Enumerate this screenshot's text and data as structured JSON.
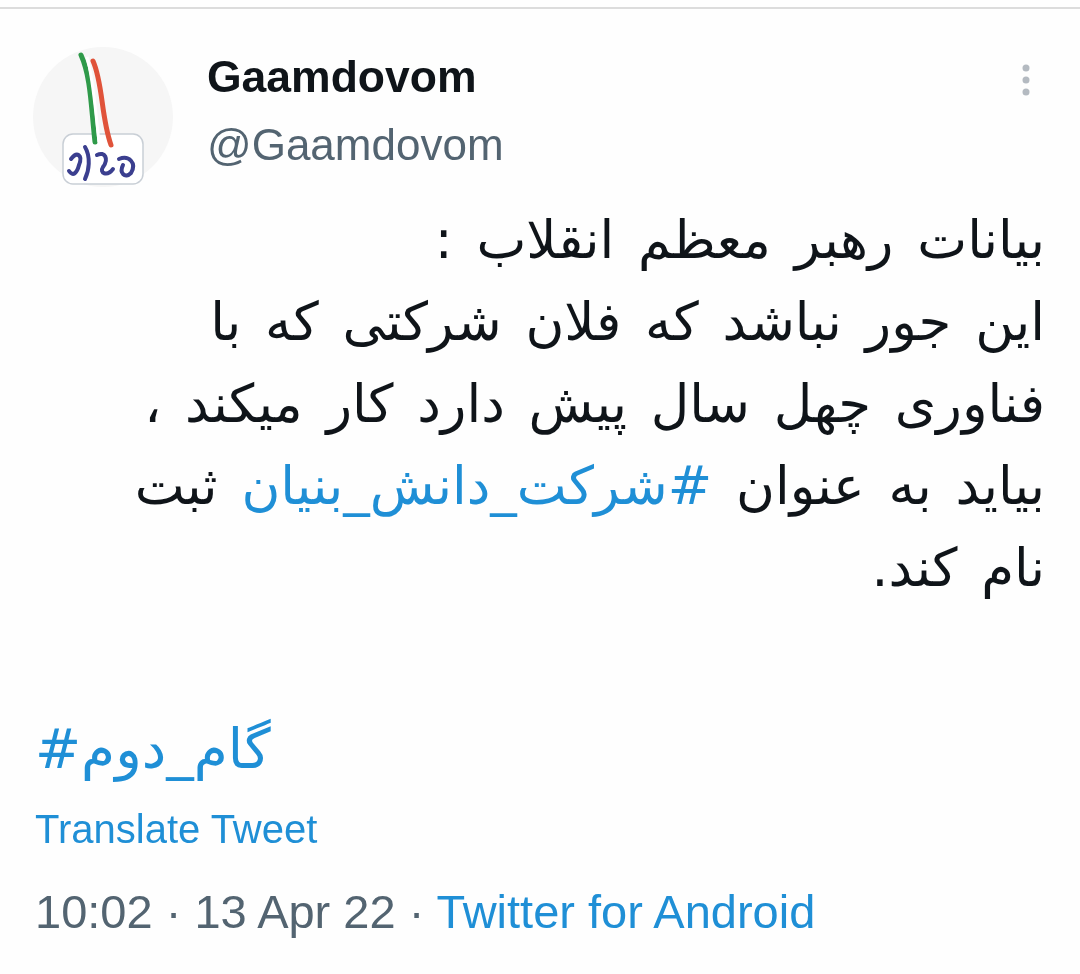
{
  "author": {
    "name": "Gaamdovom",
    "handle": "@Gaamdovom"
  },
  "tweet": {
    "body": [
      {
        "kind": "text",
        "text": "بیانات رهبر معظم انقلاب :\nاین جور نباشد که فلان شرکتی که با\nفناوری چهل سال پیش دارد کار میکند ،\nبیاید به عنوان "
      },
      {
        "kind": "hashtag",
        "text": "#شرکت_دانش_بنیان"
      },
      {
        "kind": "text",
        "text": " ثبت\nنام کند."
      }
    ],
    "tags": [
      {
        "text": "#گام_دوم"
      }
    ],
    "translate_link": "Translate Tweet"
  },
  "meta": {
    "timestamp": "10:02 · 13 Apr 22 ·",
    "source": "Twitter for Android"
  }
}
